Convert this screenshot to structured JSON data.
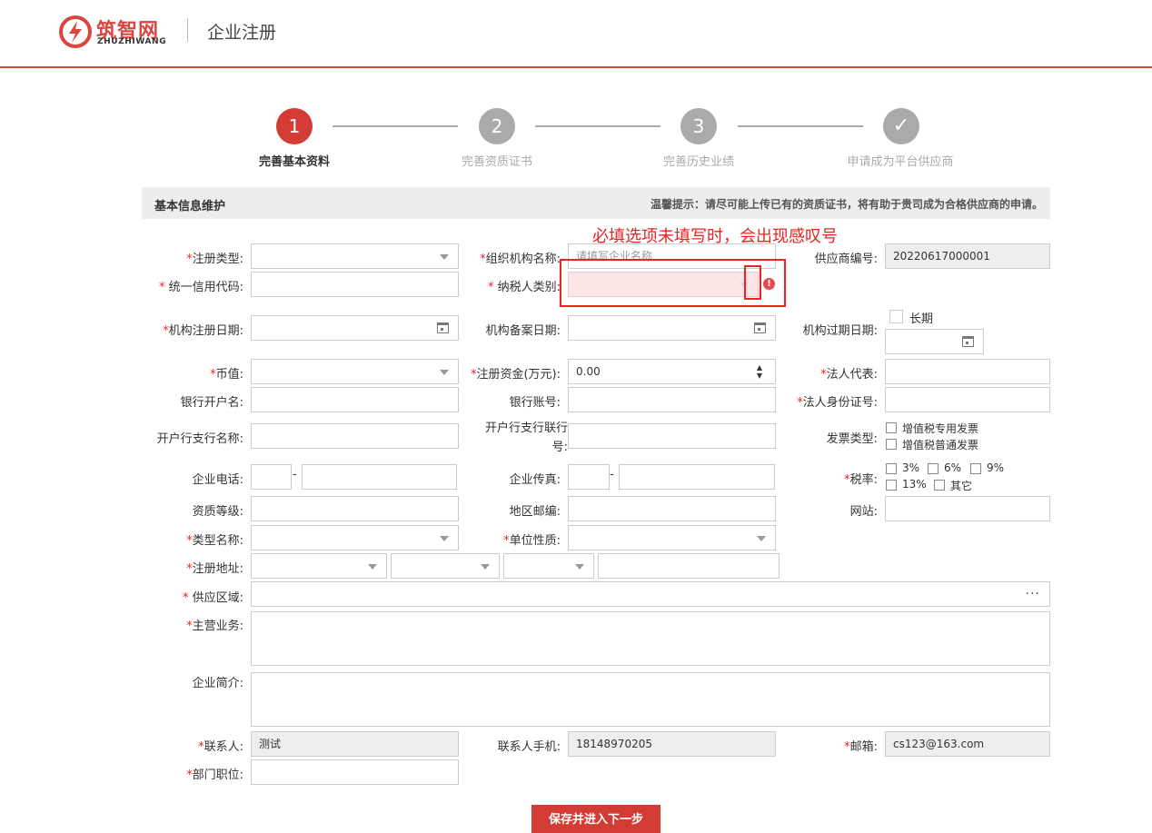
{
  "header": {
    "logo_cn": "筑智网",
    "logo_en": "ZHUZHIWANG",
    "title": "企业注册"
  },
  "steps": [
    {
      "num": "1",
      "label": "完善基本资料",
      "active": true
    },
    {
      "num": "2",
      "label": "完善资质证书",
      "active": false
    },
    {
      "num": "3",
      "label": "完善历史业绩",
      "active": false
    },
    {
      "num": "✓",
      "label": "申请成为平台供应商",
      "active": false
    }
  ],
  "section": {
    "title": "基本信息维护",
    "tip": "温馨提示：请尽可能上传已有的资质证书，将有助于贵司成为合格供应商的申请。"
  },
  "annotation": "必填选项未填写时，会出现感叹号",
  "form": {
    "reg_type": {
      "label": "注册类型:",
      "value": ""
    },
    "org_name": {
      "label": "组织机构名称:",
      "placeholder": "请填写企业名称"
    },
    "supplier_no": {
      "label": "供应商编号:",
      "value": "20220617000001"
    },
    "credit_code": {
      "label": "统一信用代码:",
      "value": ""
    },
    "taxpayer_type": {
      "label": "纳税人类别:",
      "value": ""
    },
    "reg_date": {
      "label": "机构注册日期:",
      "value": ""
    },
    "record_date": {
      "label": "机构备案日期:",
      "value": ""
    },
    "expire_date": {
      "label": "机构过期日期:",
      "value": ""
    },
    "long_term": "长期",
    "currency": {
      "label": "币值:",
      "value": ""
    },
    "reg_capital": {
      "label": "注册资金(万元):",
      "value": "0.00"
    },
    "legal_rep": {
      "label": "法人代表:",
      "value": ""
    },
    "bank_account_name": {
      "label": "银行开户名:",
      "value": ""
    },
    "bank_account_no": {
      "label": "银行账号:",
      "value": ""
    },
    "legal_id": {
      "label": "法人身份证号:",
      "value": ""
    },
    "branch_name": {
      "label": "开户行支行名称:",
      "value": ""
    },
    "branch_code_l1": "开户行支行联行",
    "branch_code_l2": "号:",
    "invoice_type": {
      "label": "发票类型:",
      "options": [
        "增值税专用发票",
        "增值税普通发票"
      ]
    },
    "phone": {
      "label": "企业电话:",
      "sep": "-"
    },
    "fax": {
      "label": "企业传真:",
      "sep": "-"
    },
    "tax_rate": {
      "label": "税率:",
      "options": [
        "3%",
        "6%",
        "9%",
        "13%",
        "其它"
      ]
    },
    "qualification": {
      "label": "资质等级:",
      "value": ""
    },
    "postcode": {
      "label": "地区邮编:",
      "value": ""
    },
    "website": {
      "label": "网站:",
      "value": ""
    },
    "type_name": {
      "label": "类型名称:",
      "value": ""
    },
    "unit_nature": {
      "label": "单位性质:",
      "value": ""
    },
    "reg_address": {
      "label": "注册地址:",
      "value": ""
    },
    "supply_area": {
      "label": "供应区域:",
      "more": "···"
    },
    "main_business": {
      "label": "主营业务:",
      "value": ""
    },
    "intro": {
      "label": "企业简介:",
      "value": ""
    },
    "contact": {
      "label": "联系人:",
      "value": "测试"
    },
    "contact_phone": {
      "label": "联系人手机:",
      "value": "18148970205"
    },
    "email": {
      "label": "邮箱:",
      "value": "cs123@163.com"
    },
    "dept_position": {
      "label": "部门职位:",
      "value": ""
    },
    "required_mark": "*",
    "error_mark": "!"
  },
  "submit_label": "保存并进入下一步",
  "colors": {
    "brand": "#d33b35",
    "error": "#e22222"
  }
}
